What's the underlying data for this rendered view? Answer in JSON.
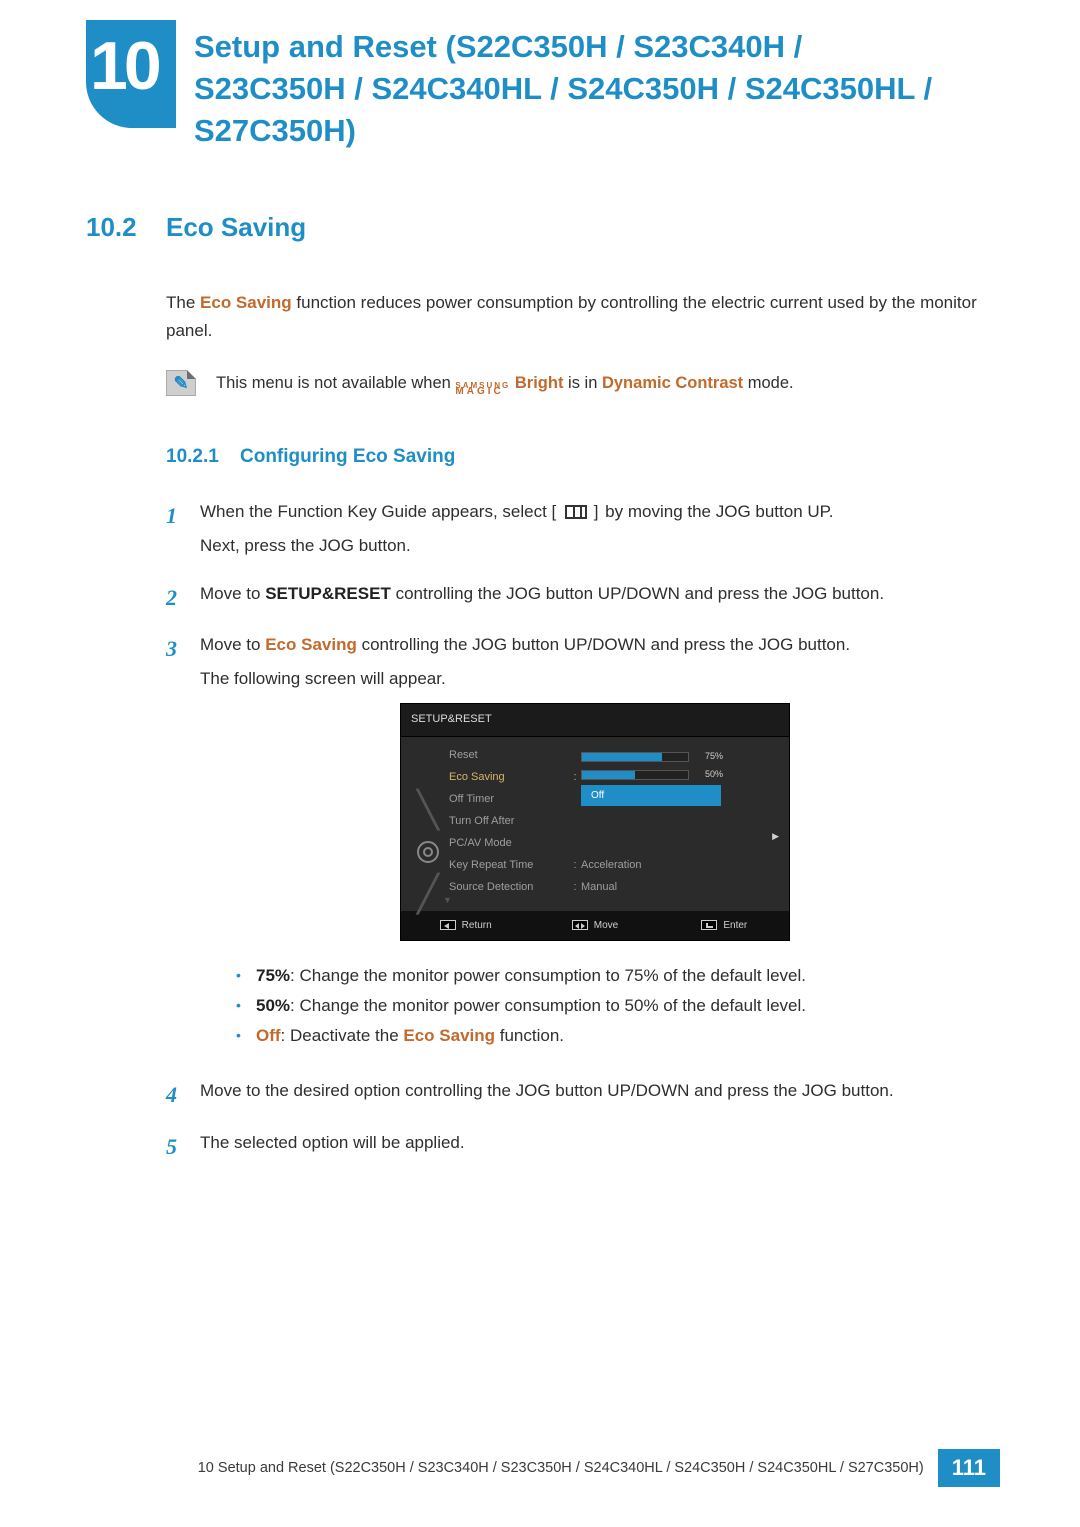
{
  "chapter": {
    "number": "10",
    "title": "Setup and Reset (S22C350H / S23C340H / S23C350H / S24C340HL / S24C350H / S24C350HL / S27C350H)"
  },
  "section": {
    "number": "10.2",
    "title": "Eco Saving",
    "intro_pre": "The ",
    "intro_kw": "Eco Saving",
    "intro_post": " function reduces power consumption by controlling the electric current used by the monitor panel."
  },
  "note": {
    "pre": "This menu is not available when ",
    "brand_top": "SAMSUNG",
    "brand_bottom": "MAGIC",
    "brand_suffix": "Bright",
    "mid": " is in ",
    "mode": "Dynamic Contrast",
    "post": " mode."
  },
  "subsection": {
    "number": "10.2.1",
    "title": "Configuring Eco Saving"
  },
  "steps": {
    "s1_a": "When the Function Key Guide appears, select ",
    "s1_b": " by moving the JOG button UP.",
    "s1_c": "Next, press the JOG button.",
    "s2_a": "Move to ",
    "s2_kw": "SETUP&RESET",
    "s2_b": " controlling the JOG button UP/DOWN and press the JOG button.",
    "s3_a": "Move to ",
    "s3_kw": "Eco Saving",
    "s3_b": " controlling the JOG button UP/DOWN and press the JOG button.",
    "s3_c": "The following screen will appear.",
    "s4": "Move to the desired option controlling the JOG button UP/DOWN and press the JOG button.",
    "s5": "The selected option will be applied."
  },
  "osd": {
    "title": "SETUP&RESET",
    "items": {
      "reset": "Reset",
      "eco": "Eco Saving",
      "offtimer": "Off Timer",
      "turnoff": "Turn Off After",
      "pcav": "PC/AV Mode",
      "keyrepeat": "Key Repeat Time",
      "srcdetect": "Source Detection"
    },
    "values": {
      "keyrepeat": "Acceleration",
      "srcdetect": "Manual"
    },
    "eco": {
      "p75": "75%",
      "p50": "50%",
      "off": "Off"
    },
    "footer": {
      "return": "Return",
      "move": "Move",
      "enter": "Enter"
    },
    "colon": ":"
  },
  "bullets": {
    "b1_kw": "75%",
    "b1_txt": ": Change the monitor power consumption to 75% of the default level.",
    "b2_kw": "50%",
    "b2_txt": ": Change the monitor power consumption to 50% of the default level.",
    "b3_kw": "Off",
    "b3_mid": ": Deactivate the ",
    "b3_kw2": "Eco Saving",
    "b3_post": " function."
  },
  "footer": {
    "text": "10 Setup and Reset (S22C350H / S23C340H / S23C350H / S24C340HL / S24C350H / S24C350HL / S27C350H)",
    "page": "111"
  }
}
